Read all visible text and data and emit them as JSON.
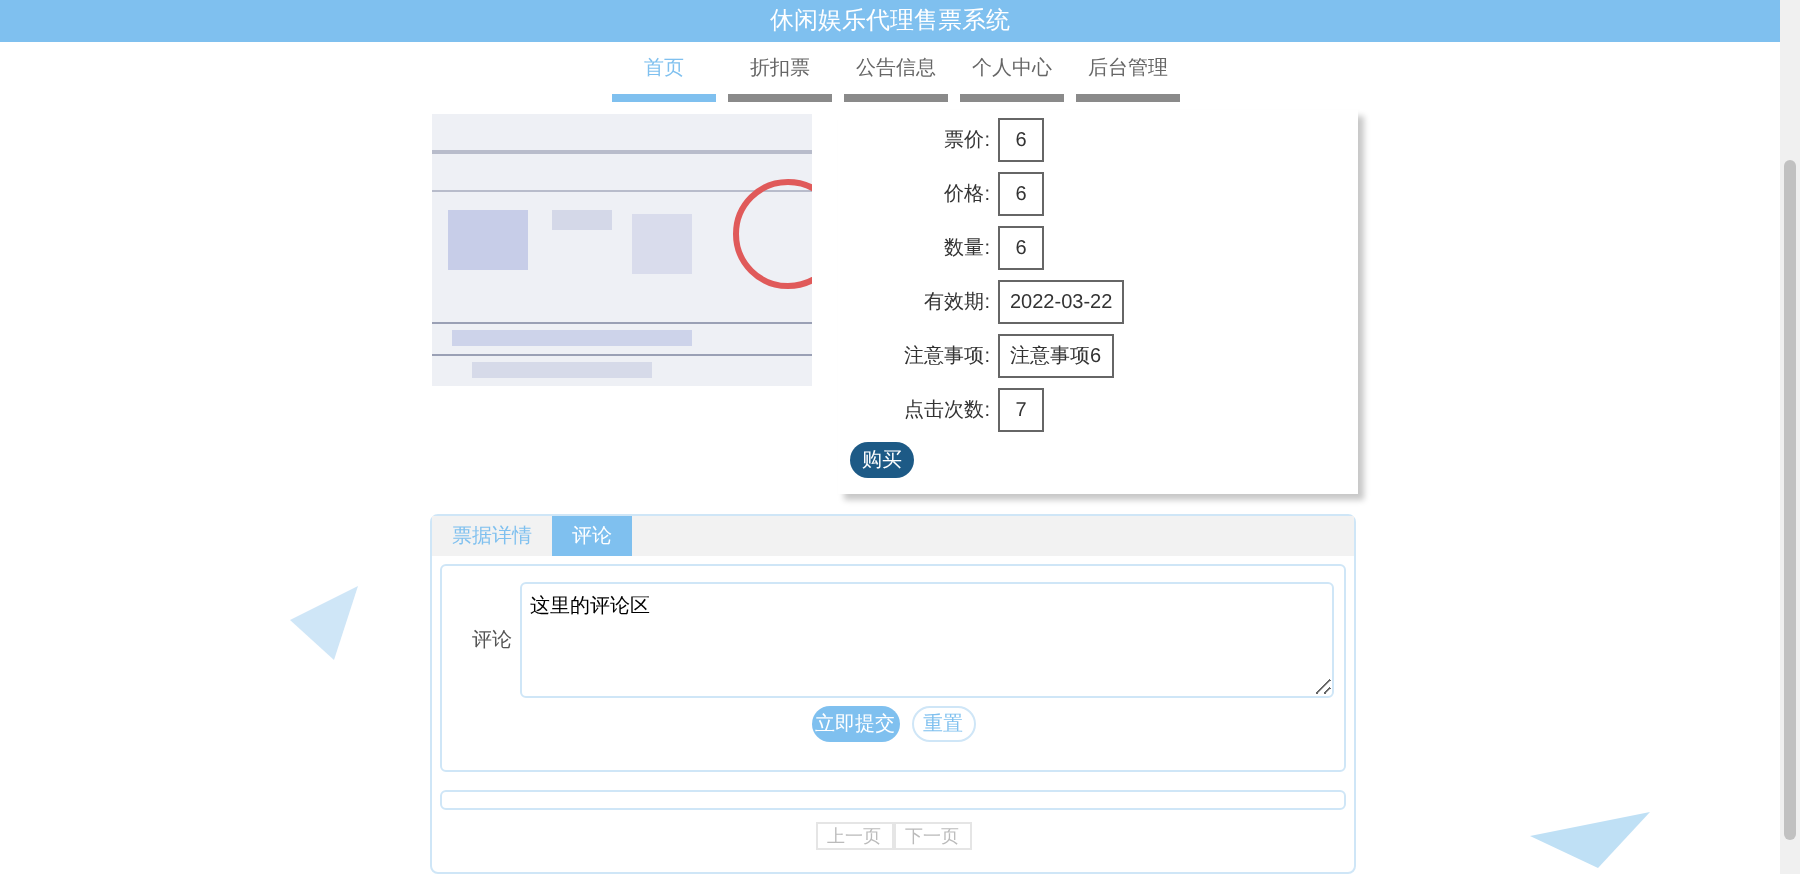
{
  "header": {
    "title": "休闲娱乐代理售票系统"
  },
  "nav": [
    {
      "label": "首页",
      "selected": true
    },
    {
      "label": "折扣票",
      "selected": false
    },
    {
      "label": "公告信息",
      "selected": false
    },
    {
      "label": "个人中心",
      "selected": false
    },
    {
      "label": "后台管理",
      "selected": false
    }
  ],
  "ticket": {
    "fields": [
      {
        "label": "票价:",
        "value": "6"
      },
      {
        "label": "价格:",
        "value": "6"
      },
      {
        "label": "数量:",
        "value": "6"
      },
      {
        "label": "有效期:",
        "value": "2022-03-22"
      },
      {
        "label": "注意事项:",
        "value": "注意事项6"
      },
      {
        "label": "点击次数:",
        "value": "7"
      }
    ],
    "buy_button": "购买"
  },
  "tabs": [
    {
      "label": "票据详情",
      "selected": false
    },
    {
      "label": "评论",
      "selected": true
    }
  ],
  "comment_form": {
    "label": "评论",
    "value": "这里的评论区",
    "submit": "立即提交",
    "reset": "重置"
  },
  "pager": [
    {
      "label": "上一页",
      "disabled": true
    },
    {
      "label": "下一页",
      "disabled": true
    }
  ]
}
